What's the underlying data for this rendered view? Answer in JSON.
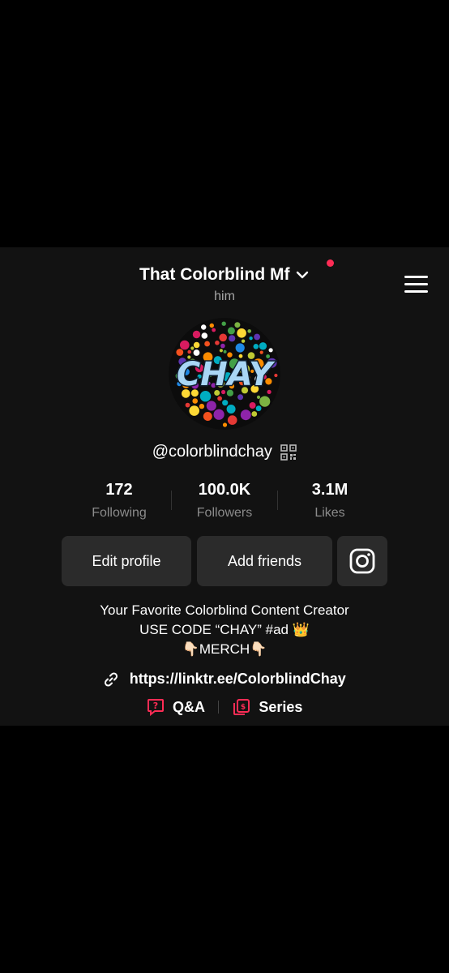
{
  "header": {
    "title": "That Colorblind Mf",
    "pronouns": "him",
    "notification_color": "#fe2c55"
  },
  "icons": {
    "dropdown": "chevron-down-icon",
    "menu": "hamburger-menu-icon",
    "qr": "qr-code-icon",
    "instagram": "instagram-icon",
    "link": "link-icon",
    "qa": "question-bubble-icon",
    "series": "series-icon"
  },
  "avatar": {
    "text": "CHAY"
  },
  "profile": {
    "handle": "@colorblindchay"
  },
  "stats": [
    {
      "value": "172",
      "label": "Following"
    },
    {
      "value": "100.0K",
      "label": "Followers"
    },
    {
      "value": "3.1M",
      "label": "Likes"
    }
  ],
  "actions": {
    "edit_profile": "Edit profile",
    "add_friends": "Add friends"
  },
  "bio": {
    "line1": "Your Favorite Colorblind Content Creator",
    "line2": "USE CODE “CHAY” #ad 👑",
    "line3": "👇🏻MERCH👇🏻"
  },
  "link": {
    "url": "https://linktr.ee/ColorblindChay"
  },
  "tags": {
    "qa": "Q&A",
    "series": "Series",
    "accent": "#fe2c55"
  }
}
